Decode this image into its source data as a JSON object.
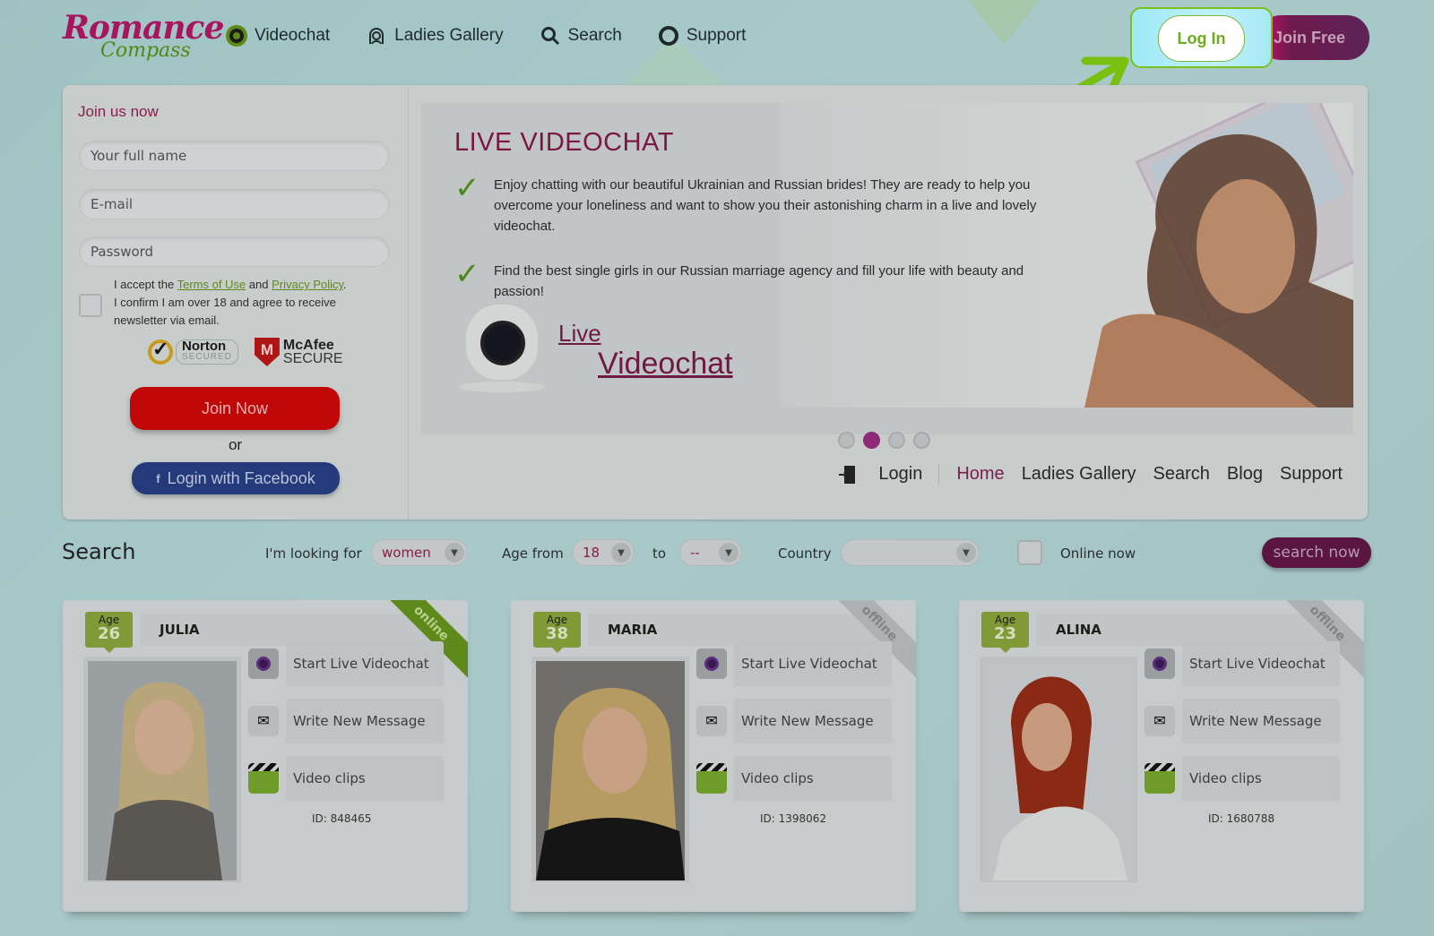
{
  "brand": {
    "line1": "Romance",
    "line2": "Compass"
  },
  "nav": {
    "items": [
      {
        "label": "Videochat",
        "icon": "videochat-icon"
      },
      {
        "label": "Ladies Gallery",
        "icon": "ladies-gallery-icon"
      },
      {
        "label": "Search",
        "icon": "search-icon"
      },
      {
        "label": "Support",
        "icon": "support-lifebuoy-icon"
      }
    ],
    "login_label": "Log In",
    "join_free_label": "Join Free"
  },
  "join_form": {
    "title": "Join us now",
    "name_placeholder": "Your full name",
    "email_placeholder": "E-mail",
    "password_placeholder": "Password",
    "terms_prefix": "I accept the ",
    "terms_link": "Terms of Use",
    "terms_and": " and ",
    "privacy_link": "Privacy Policy",
    "terms_suffix": ".",
    "terms_line2": "I confirm I am over 18 and agree to receive newsletter via email.",
    "norton_title": "Norton",
    "norton_sub": "SECURED",
    "mcafee_title": "McAfee",
    "mcafee_sub": "SECURE",
    "join_now_label": "Join Now",
    "or_label": "or",
    "facebook_label": "Login with Facebook"
  },
  "hero": {
    "title": "LIVE VIDEOCHAT",
    "bullets": [
      "Enjoy chatting with our beautiful Ukrainian and Russian brides! They are ready to help you overcome your loneliness and want to show you their astonishing charm in a live and lovely videochat.",
      "Find the best single girls in our Russian marriage agency and fill your life with beauty and passion!"
    ],
    "link_line1": "Live",
    "link_line2": "Videochat",
    "slides_total": 4,
    "active_slide": 2
  },
  "sub_nav": {
    "login": "Login",
    "items": [
      "Home",
      "Ladies Gallery",
      "Search",
      "Blog",
      "Support"
    ],
    "active": "Home"
  },
  "search": {
    "title": "Search",
    "looking_for_label": "I'm looking for",
    "looking_for_value": "women",
    "age_from_label": "Age from",
    "age_from_value": "18",
    "to_label": "to",
    "age_to_value": "--",
    "country_label": "Country",
    "country_value": "",
    "online_label": "Online now",
    "button_label": "search now"
  },
  "profiles": [
    {
      "age_label": "Age",
      "age": "26",
      "name": "JULIA",
      "status": "online",
      "id": "ID: 848465"
    },
    {
      "age_label": "Age",
      "age": "38",
      "name": "MARIA",
      "status": "offline",
      "id": "ID: 1398062"
    },
    {
      "age_label": "Age",
      "age": "23",
      "name": "ALINA",
      "status": "offline",
      "id": "ID: 1680788"
    }
  ],
  "profile_actions": {
    "videochat": "Start Live Videochat",
    "message": "Write New Message",
    "clips": "Video clips"
  }
}
